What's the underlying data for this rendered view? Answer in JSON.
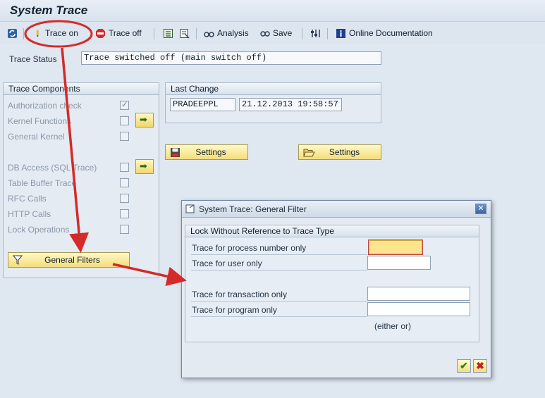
{
  "app": {
    "title": "System Trace"
  },
  "toolbar": {
    "trace_on": "Trace on",
    "trace_off": "Trace off",
    "analysis": "Analysis",
    "save": "Save",
    "online_doc": "Online Documentation"
  },
  "status": {
    "label": "Trace Status",
    "value": "Trace switched off (main switch off)"
  },
  "components": {
    "title": "Trace Components",
    "items": [
      {
        "label": "Authorization check",
        "checked": true
      },
      {
        "label": "Kernel Functions",
        "checked": false
      },
      {
        "label": "General Kernel",
        "checked": false
      },
      {
        "label": "DB Access (SQL Trace)",
        "checked": false
      },
      {
        "label": "Table Buffer Trace",
        "checked": false
      },
      {
        "label": "RFC Calls",
        "checked": false
      },
      {
        "label": "HTTP Calls",
        "checked": false
      },
      {
        "label": "Lock Operations",
        "checked": false
      }
    ],
    "general_filters": "General Filters"
  },
  "last_change": {
    "title": "Last Change",
    "user": "PRADEEPPL",
    "timestamp": "21.12.2013 19:58:57"
  },
  "settings_save": "Settings",
  "settings_load": "Settings",
  "dialog": {
    "title": "System Trace: General Filter",
    "group_title": "Lock Without Reference to Trace Type",
    "process_label": "Trace for process number only",
    "user_label": "Trace for user only",
    "transaction_label": "Trace for transaction only",
    "program_label": "Trace for program only",
    "either_or": "(either or)"
  },
  "colors": {
    "annotation_red": "#d42a2a",
    "button_yellow": "#f5dd7a"
  }
}
